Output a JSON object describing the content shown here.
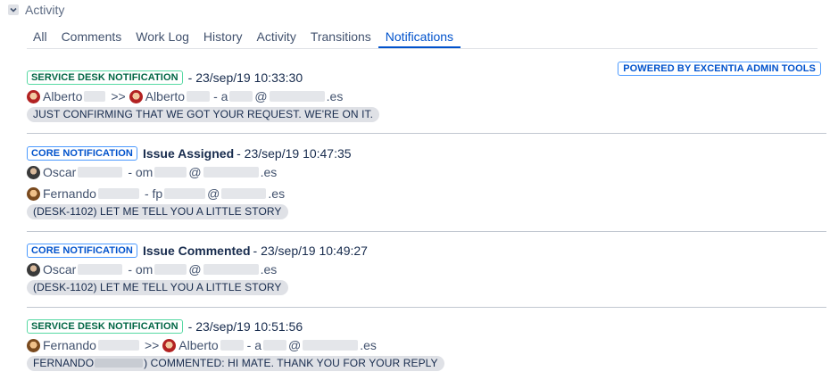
{
  "section": {
    "title": "Activity"
  },
  "tabs": [
    {
      "label": "All"
    },
    {
      "label": "Comments"
    },
    {
      "label": "Work Log"
    },
    {
      "label": "History"
    },
    {
      "label": "Activity"
    },
    {
      "label": "Transitions"
    },
    {
      "label": "Notifications"
    }
  ],
  "active_tab": "Notifications",
  "powered_by": "POWERED BY EXCENTIA ADMIN TOOLS",
  "entries": [
    {
      "type": "SERVICE DESK NOTIFICATION",
      "timestamp": "- 23/sep/19 10:33:30",
      "from_name": "Alberto",
      "arrow": ">>",
      "to_name": "Alberto",
      "to_email_pre": "- a",
      "to_email_mid": "@",
      "to_email_end": ".es",
      "message": "JUST CONFIRMING THAT WE GOT YOUR REQUEST. WE'RE ON IT."
    },
    {
      "type": "CORE NOTIFICATION",
      "title": "Issue Assigned",
      "timestamp": "- 23/sep/19 10:47:35",
      "r1_name": "Oscar",
      "r1_email_pre": "- om",
      "r1_email_mid": "@",
      "r1_email_end": ".es",
      "r2_name": "Fernando",
      "r2_email_pre": "- fp",
      "r2_email_mid": "@",
      "r2_email_end": ".es",
      "message": "(DESK-1102) LET ME TELL YOU A LITTLE STORY"
    },
    {
      "type": "CORE NOTIFICATION",
      "title": "Issue Commented",
      "timestamp": "- 23/sep/19 10:49:27",
      "r1_name": "Oscar",
      "r1_email_pre": "- om",
      "r1_email_mid": "@",
      "r1_email_end": ".es",
      "message": "(DESK-1102) LET ME TELL YOU A LITTLE STORY"
    },
    {
      "type": "SERVICE DESK NOTIFICATION",
      "timestamp": "- 23/sep/19 10:51:56",
      "from_name": "Fernando",
      "arrow": ">>",
      "to_name": "Alberto",
      "to_email_pre": "- a",
      "to_email_mid": "@",
      "to_email_end": ".es",
      "message_pre": "FERNANDO",
      "message_post": ") COMMENTED: HI MATE. THANK YOU FOR YOUR REPLY"
    }
  ]
}
